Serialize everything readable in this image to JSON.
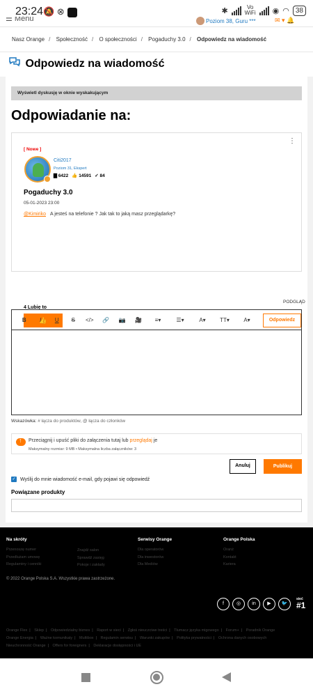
{
  "status_bar": {
    "time": "23:24",
    "left_icons": "🔕 ⊗",
    "vowifi_top": "Vo",
    "vowifi_bottom": "WiFi",
    "battery": "38"
  },
  "top_nav": {
    "menu_label": "☰ Menu",
    "user_rank": "Poziom 38, Guru ***"
  },
  "breadcrumb": [
    "Nasz Orange",
    "Społeczność",
    "O społeczności",
    "Pogaduchy 3.0",
    "Odpowiedz na wiadomość"
  ],
  "page_title": "Odpowiedz na wiadomość",
  "popup_link": "Wyświetl dyskusję w oknie wyskakującym",
  "reply_heading": "Odpowiadanie na:",
  "message": {
    "tag": "[ Nowe ]",
    "author": "Citi2017",
    "rank": "Poziom 31, Ekspert",
    "posts": "6422",
    "likes": "14591",
    "solutions": "84",
    "subject": "Pogaduchy 3.0",
    "date": "05-01-2023 23:00",
    "mention": "@Kimiriko",
    "body": "A jesteś na telefonie ? Jak tak to jaką masz przeglądarkę?",
    "like_count": "4 Lubię to",
    "reply_button": "Odpowiedz"
  },
  "editor": {
    "preview_label": "PODGLĄD",
    "tools": [
      "B",
      "I",
      "U",
      "S",
      "</>",
      "🔗",
      "📷",
      "🎥",
      "≡▾",
      "☰▾",
      "A▾",
      "TT▾",
      "A▾"
    ]
  },
  "hints": {
    "label": "Wskazówka:",
    "text": "# łącza do produktów, @ łącza do członków"
  },
  "upload": {
    "text_before": "Przeciągnij i upuść pliki do załączenia tutaj lub",
    "link": "przeglądaj",
    "text_after": "je",
    "limits": "Maksymalny rozmiar: 9 MB • Maksymalna liczba załączników: 3"
  },
  "actions": {
    "cancel": "Anuluj",
    "publish": "Publikuj"
  },
  "notify_label": "Wyślij do mnie wiadomość e-mail, gdy pojawi się odpowiedź",
  "related_products": "Powiązane produkty",
  "footer": {
    "col1": {
      "title": "Na skróty",
      "items": [
        "Przenoszę numer",
        "Przedłużam umowę",
        "Regulaminy i cenniki"
      ]
    },
    "col2": {
      "items": [
        "Znajdź salon",
        "Sprawdź zasięg",
        "Pokoje i zakłady"
      ]
    },
    "col3": {
      "title": "Serwisy Orange",
      "items": [
        "Dla operatorów",
        "Dla inwestorów",
        "Dla Mediów"
      ]
    },
    "col4": {
      "title": "Orange Polska",
      "items": [
        "Oranż",
        "Kontakt",
        "Kariera"
      ]
    },
    "copyright": "© 2022 Orange Polska S.A.  Wszystkie prawa zastrzeżone.",
    "social": [
      "f",
      "◎",
      "in",
      "▶",
      "🐦"
    ],
    "badge_top": "sieć",
    "badge_num": "#1",
    "links": [
      "Orange Flex",
      "Sklep",
      "Odpowiedzialny biznes",
      "Raport w sieci",
      "Zgłoś nieuczciwe treści",
      "Tłumacz języka migowego",
      "Forum+",
      "Poradnik Orange",
      "Orange Energia",
      "Ważne komunikaty",
      "Multibox",
      "Regulamin serwisu",
      "Warunki zakupów",
      "Polityka prywatności",
      "Ochrona danych osobowych",
      "Nieuchronność Orange",
      "Offers for foreigners",
      "Deklaracje dostępności i UE"
    ]
  }
}
